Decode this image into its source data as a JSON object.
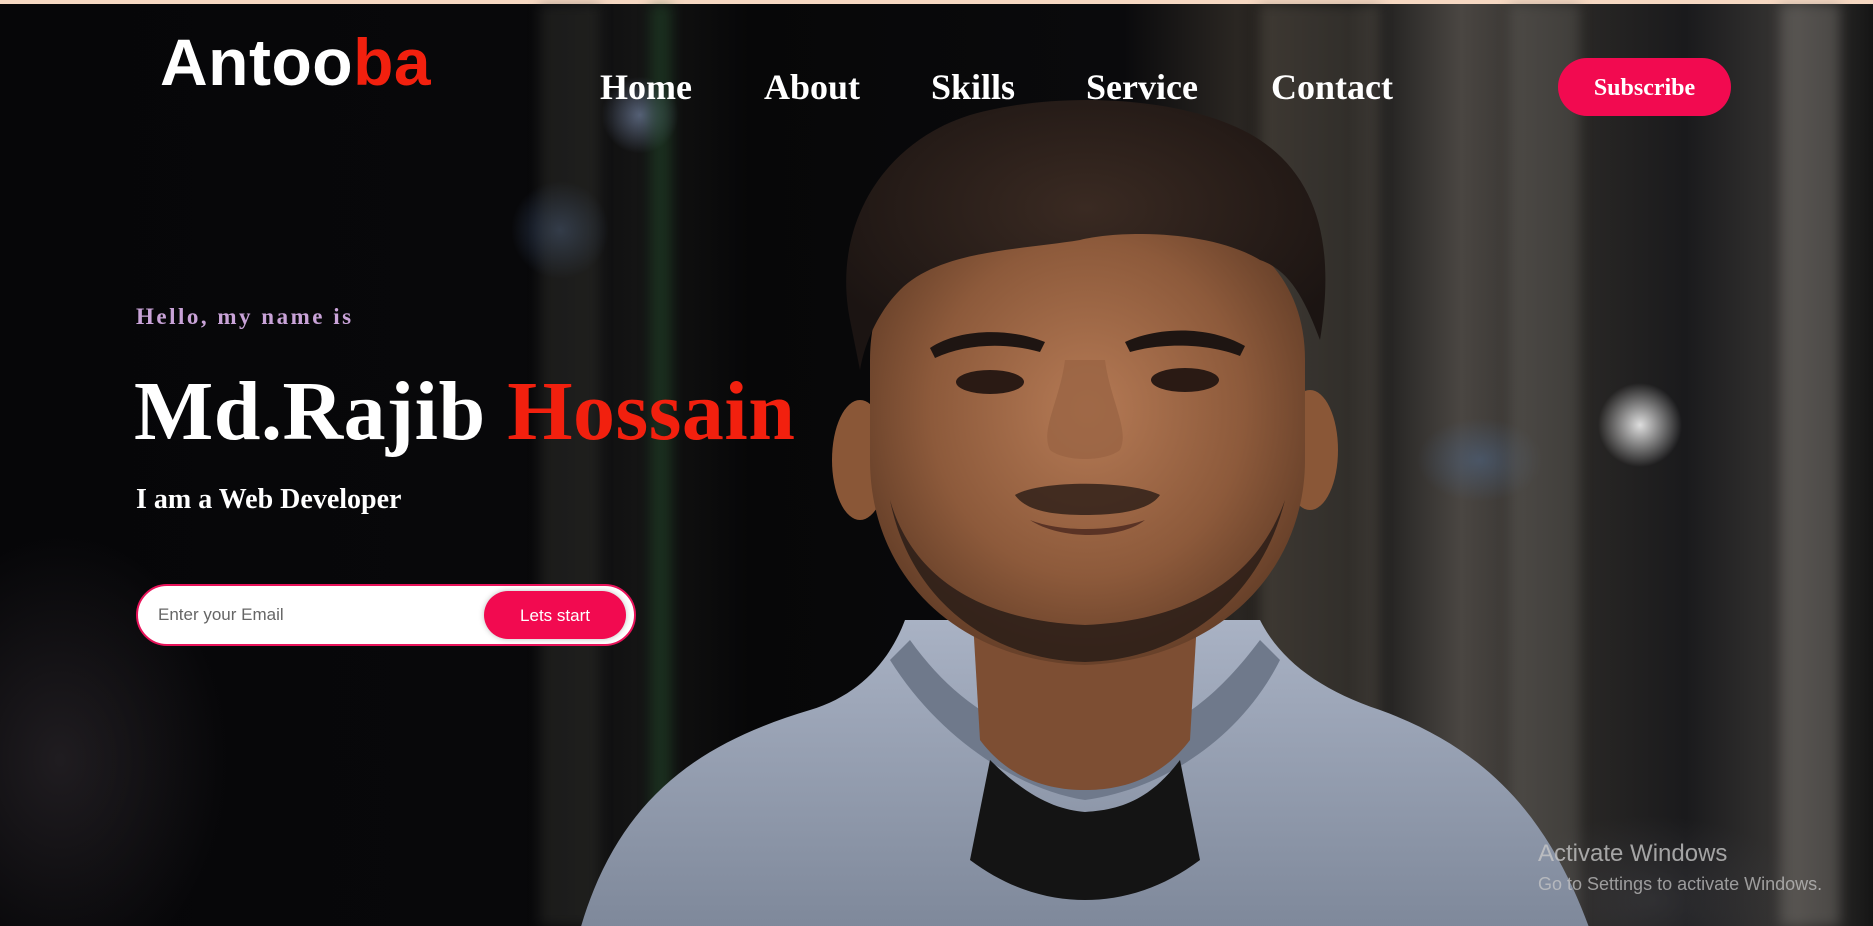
{
  "header": {
    "logo": {
      "part1": "Antoo",
      "part2": "ba"
    },
    "nav": [
      {
        "label": "Home"
      },
      {
        "label": "About"
      },
      {
        "label": "Skills"
      },
      {
        "label": "Service"
      },
      {
        "label": "Contact"
      }
    ],
    "subscribe_label": "Subscribe"
  },
  "hero": {
    "greeting": "Hello, my name is",
    "first_name": "Md.Rajib",
    "last_name": "Hossain",
    "tagline": "I am a Web Developer",
    "email_placeholder": "Enter your Email",
    "email_value": "",
    "cta_label": "Lets start"
  },
  "watermark": {
    "title": "Activate Windows",
    "subtitle": "Go to Settings to activate Windows."
  },
  "colors": {
    "accent_red": "#f2200e",
    "button_pink": "#f20a50",
    "greeting_lilac": "#c9a3d8",
    "top_strip": "#f6d8c2"
  }
}
